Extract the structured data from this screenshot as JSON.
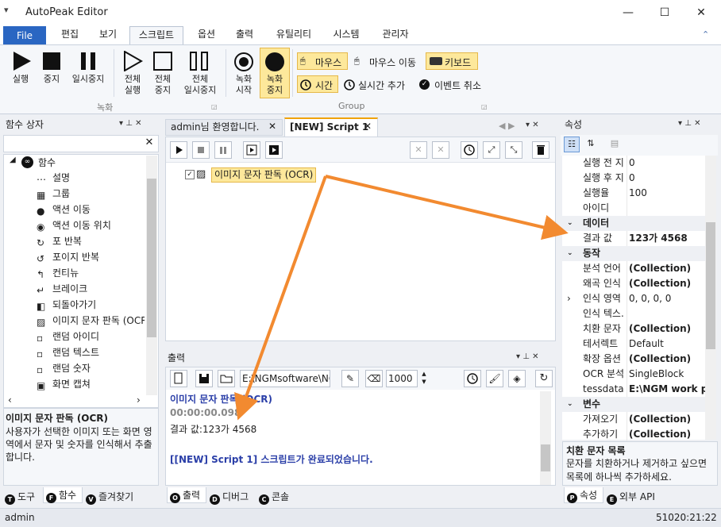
{
  "app": {
    "title": "AutoPeak Editor"
  },
  "window": {
    "min": "—",
    "max": "☐",
    "close": "✕"
  },
  "ribbon_tabs": [
    "File",
    "편집",
    "보기",
    "스크립트",
    "옵션",
    "출력",
    "유틸리티",
    "시스템",
    "관리자"
  ],
  "ribbon": {
    "run": "실행",
    "stop": "중지",
    "pause": "일시중지",
    "run_all_1": "전체",
    "run_all_2": "실행",
    "stop_all_1": "전체",
    "stop_all_2": "중지",
    "pause_all_1": "전체",
    "pause_all_2": "일시중지",
    "rec_start_1": "녹화",
    "rec_start_2": "시작",
    "rec_stop_1": "녹화",
    "rec_stop_2": "중지",
    "group_record": "녹화",
    "group_group": "Group",
    "mouse": "마우스",
    "mouse_move": "마우스 이동",
    "keyboard": "키보드",
    "time": "시간",
    "realtime_add": "실시간 추가",
    "event_cancel": "이벤트 취소"
  },
  "left_panel": {
    "title": "함수 상자",
    "root": "함수",
    "items": [
      "설명",
      "그룹",
      "액션 이동",
      "액션 이동 위치",
      "포 반복",
      "포이지 반복",
      "컨티뉴",
      "브레이크",
      "되돌아가기",
      "이미지 문자 판독 (OCR)",
      "랜덤 아이디",
      "랜덤 텍스트",
      "랜덤 숫자",
      "화면 캡쳐"
    ],
    "desc_title": "이미지 문자 판독 (OCR)",
    "desc_text": "사용자가 선택한 이미지 또는 화면 영역에서 문자 및 숫자를 인식해서 추출합니다.",
    "tabs": [
      {
        "key": "T",
        "label": "도구"
      },
      {
        "key": "F",
        "label": "함수"
      },
      {
        "key": "V",
        "label": "즐겨찾기"
      }
    ]
  },
  "editor": {
    "tabs": [
      "admin님 환영합니다.",
      "[NEW] Script 1"
    ],
    "script_item": "이미지 문자 판독 (OCR)"
  },
  "output": {
    "title": "출력",
    "path": "E:\\NGMsoftware\\NG",
    "count": "1000",
    "lines": [
      {
        "text": "이미지 문자 판독 (OCR)",
        "color": "#2b3fa8",
        "bold": true
      },
      {
        "text": "00:00:00.098",
        "color": "#888888",
        "bold": true
      },
      {
        "text": "결과 값:123가 4568",
        "color": "#1e1e1e",
        "bold": false
      },
      {
        "text": "",
        "color": "#1e1e1e",
        "bold": false
      },
      {
        "text": "[[NEW] Script 1] 스크립트가 완료되었습니다.",
        "color": "#2b3fa8",
        "bold": true
      }
    ],
    "tabs": [
      {
        "key": "O",
        "label": "출력"
      },
      {
        "key": "D",
        "label": "디버그"
      },
      {
        "key": "C",
        "label": "콘솔"
      }
    ]
  },
  "properties": {
    "title": "속성",
    "rows": [
      {
        "key": "실행 전 지",
        "value": "0",
        "cat": false
      },
      {
        "key": "실행 후 지",
        "value": "0",
        "cat": false
      },
      {
        "key": "실행율",
        "value": "100",
        "cat": false
      },
      {
        "key": "아이디",
        "value": "",
        "cat": false
      },
      {
        "key": "데이터",
        "value": "",
        "cat": true
      },
      {
        "key": "결과 값",
        "value": "123가 4568",
        "cat": false,
        "bold": true
      },
      {
        "key": "동작",
        "value": "",
        "cat": true
      },
      {
        "key": "분석 언어",
        "value": "(Collection)",
        "cat": false,
        "bold": true
      },
      {
        "key": "왜곡 인식",
        "value": "(Collection)",
        "cat": false,
        "bold": true
      },
      {
        "key": "인식 영역",
        "value": "0, 0, 0, 0",
        "cat": false,
        "expand": true
      },
      {
        "key": "인식 텍스.",
        "value": "",
        "cat": false
      },
      {
        "key": "치환 문자",
        "value": "(Collection)",
        "cat": false,
        "bold": true
      },
      {
        "key": "테서렉트",
        "value": "Default",
        "cat": false
      },
      {
        "key": "확장 옵션",
        "value": "(Collection)",
        "cat": false,
        "bold": true
      },
      {
        "key": "OCR 분석",
        "value": "SingleBlock",
        "cat": false
      },
      {
        "key": "tessdata",
        "value": "E:\\NGM work p",
        "cat": false,
        "bold": true
      },
      {
        "key": "변수",
        "value": "",
        "cat": true
      },
      {
        "key": "가져오기",
        "value": "(Collection)",
        "cat": false,
        "bold": true
      },
      {
        "key": "추가하기",
        "value": "(Collection)",
        "cat": false,
        "bold": true
      }
    ],
    "desc_title": "치환 문자 목록",
    "desc_text": "문자를 치환하거나 제거하고 싶으면 목록에 하나씩 추가하세요.",
    "tabs": [
      {
        "key": "P",
        "label": "속성"
      },
      {
        "key": "E",
        "label": "외부 API"
      }
    ]
  },
  "status": {
    "user": "admin",
    "time": "51020:21:22"
  },
  "colors": {
    "accent": "#2a66c2",
    "arrow": "#f28a30",
    "toggle": "#fde89b"
  }
}
